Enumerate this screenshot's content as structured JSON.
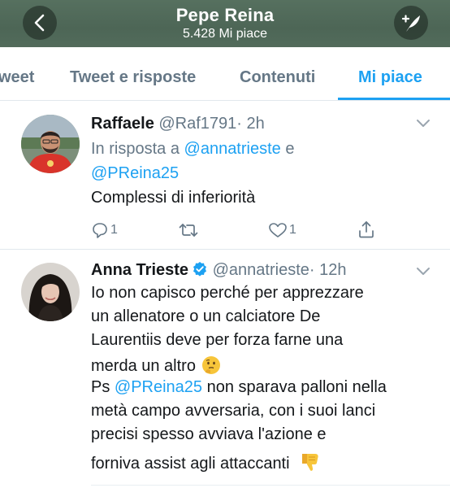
{
  "header": {
    "title": "Pepe Reina",
    "subtitle": "5.428 Mi piace"
  },
  "tabs": [
    {
      "label": "weet"
    },
    {
      "label": "Tweet e risposte"
    },
    {
      "label": "Contenuti"
    },
    {
      "label": "Mi piace",
      "active": true
    }
  ],
  "tweets": [
    {
      "name": "Raffaele",
      "handle": "@Raf1791",
      "time": "· 2h",
      "reply_prefix": "In risposta a",
      "reply_user1": "@annatrieste",
      "reply_and": "e",
      "reply_user2": "@PReina25",
      "text": "Complessi di inferiorità",
      "reply_count": "1",
      "like_count": "1"
    },
    {
      "name": "Anna Trieste",
      "verified": true,
      "handle": "@annatrieste",
      "time": "· 12h",
      "lines": [
        "Io non capisco perché per apprezzare",
        "un allenatore o un calciatore De",
        "Laurentiis deve per forza farne una",
        "merda un altro",
        "Ps",
        "@PReina25",
        "non sparava palloni nella",
        "metà campo avversaria, con i suoi lanci",
        "precisi spesso avviava l'azione e",
        "forniva assist agli attaccanti"
      ],
      "emoji_thinking": "🤔",
      "emoji_thumbsdown": "👎"
    }
  ],
  "colors": {
    "accent": "#1da1f2",
    "header_bg": "#526b5b",
    "secondary_text": "#657786"
  }
}
